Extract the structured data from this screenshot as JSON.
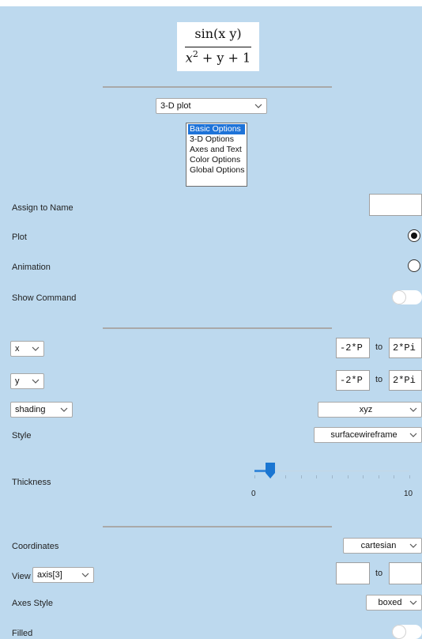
{
  "formula": {
    "numerator": "sin(x y)",
    "denominator_base": "x",
    "denominator_exponent": "2",
    "denominator_rest": " + y + 1"
  },
  "plot_type": {
    "selected": "3-D plot"
  },
  "options_list": {
    "items": [
      "Basic Options",
      "3-D Options",
      "Axes and Text",
      "Color Options",
      "Global Options"
    ],
    "selected_index": 0
  },
  "assign_to_name": {
    "label": "Assign to Name",
    "value": ""
  },
  "plot": {
    "label": "Plot",
    "selected": true
  },
  "animation": {
    "label": "Animation",
    "selected": false
  },
  "show_command": {
    "label": "Show Command",
    "on": false
  },
  "x_range": {
    "variable": "x",
    "from": "-2*P",
    "to_label": "to",
    "to": "2*Pi"
  },
  "y_range": {
    "variable": "y",
    "from": "-2*P",
    "to_label": "to",
    "to": "2*Pi"
  },
  "shading": {
    "option": "shading",
    "value": "xyz"
  },
  "style": {
    "label": "Style",
    "value": "surfacewireframe"
  },
  "thickness": {
    "label": "Thickness",
    "min_label": "0",
    "max_label": "10",
    "min": 0,
    "max": 10,
    "value": 1
  },
  "coordinates": {
    "label": "Coordinates",
    "value": "cartesian"
  },
  "view": {
    "label": "View",
    "option": "axis[3]",
    "from": "",
    "to_label": "to",
    "to": ""
  },
  "axes_style": {
    "label": "Axes Style",
    "value": "boxed"
  },
  "filled": {
    "label": "Filled",
    "on": false
  },
  "colors": {
    "panel": "#bdd9ee",
    "selection": "#1e73d8",
    "slider": "#1a76d2"
  }
}
